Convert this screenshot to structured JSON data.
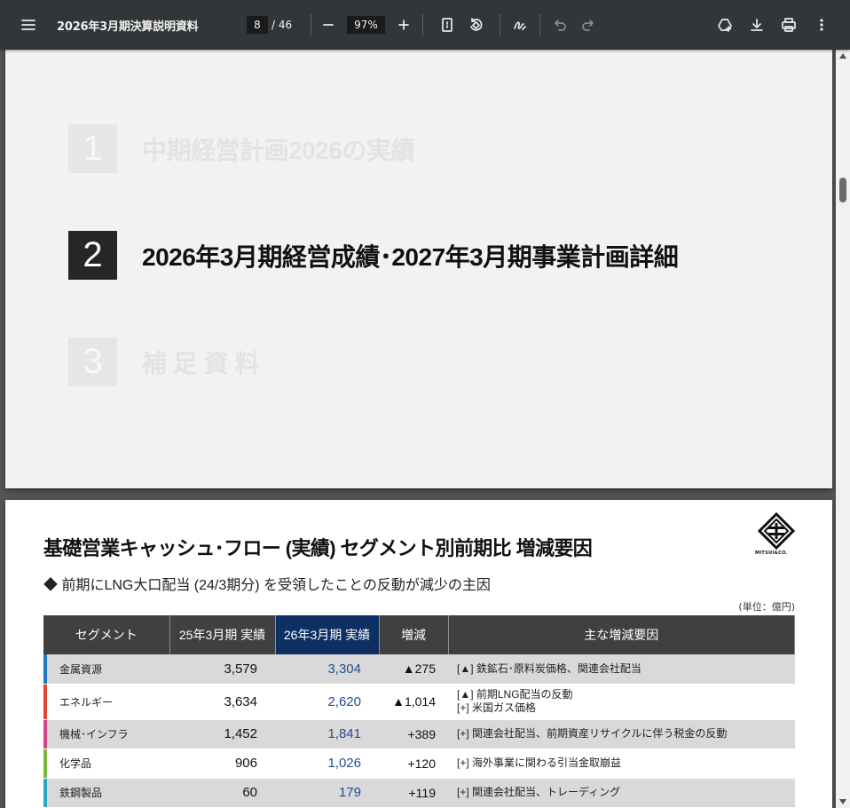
{
  "toolbar": {
    "title": "2026年3月期決算説明資料",
    "page_current": "8",
    "page_total": "/ 46",
    "zoom": "97%"
  },
  "divider": {
    "sections": [
      {
        "num": "1",
        "title": "中期経営計画2026の実績",
        "state": "dim"
      },
      {
        "num": "2",
        "title": "2026年3月期経営成績･2027年3月期事業計画詳細",
        "state": "active"
      },
      {
        "num": "3",
        "title": "補 足 資 料",
        "state": "dim"
      }
    ]
  },
  "slide": {
    "title": "基礎営業キャッシュ･フロー (実績) セグメント別前期比 増減要因",
    "subtitle": "◆ 前期にLNG大口配当 (24/3期分) を受領したことの反動が減少の主因",
    "unit": "(単位：億円)",
    "logo_text": "MITSUI&CO.",
    "table": {
      "headers": [
        "セグメント",
        "25年3月期 実績",
        "26年3月期 実績",
        "増減",
        "主な増減要因"
      ],
      "rows": [
        {
          "segment": "金属資源",
          "prev": "3,579",
          "cur": "3,304",
          "diff": "▲275",
          "reason1": "[▲] 鉄鉱石･原料炭価格、関連会社配当",
          "reason2": "",
          "color": "#1f78c8"
        },
        {
          "segment": "エネルギー",
          "prev": "3,634",
          "cur": "2,620",
          "diff": "▲1,014",
          "reason1": "[▲] 前期LNG配当の反動",
          "reason2": "[+] 米国ガス価格",
          "color": "#e0452f"
        },
        {
          "segment": "機械･インフラ",
          "prev": "1,452",
          "cur": "1,841",
          "diff": "+389",
          "reason1": "[+] 関連会社配当、前期資産リサイクルに伴う税金の反動",
          "reason2": "",
          "color": "#d6458a"
        },
        {
          "segment": "化学品",
          "prev": "906",
          "cur": "1,026",
          "diff": "+120",
          "reason1": "[+] 海外事業に関わる引当金取崩益",
          "reason2": "",
          "color": "#7ab83a"
        },
        {
          "segment": "鉄鋼製品",
          "prev": "60",
          "cur": "179",
          "diff": "+119",
          "reason1": "[+] 関連会社配当、トレーディング",
          "reason2": "",
          "color": "#2aa6c8"
        }
      ]
    }
  }
}
